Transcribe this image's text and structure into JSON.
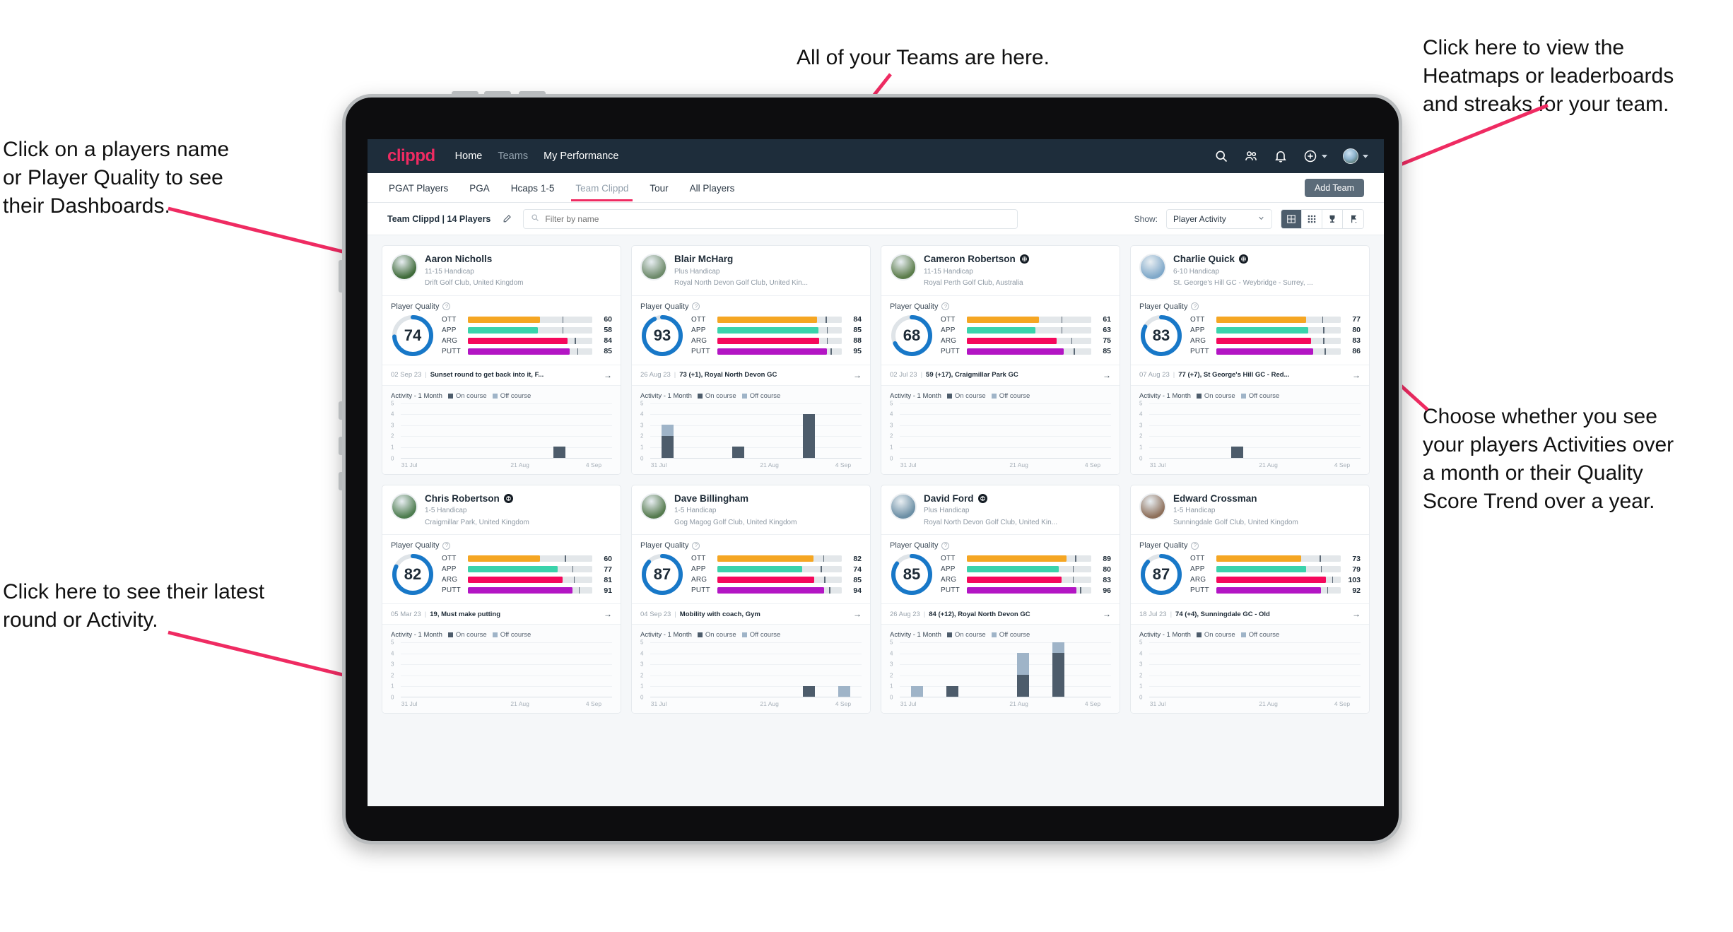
{
  "colors": {
    "brand_pink": "#ef2b62",
    "nav_bg": "#1e2d3b",
    "ott": "#f5a623",
    "app": "#3ad3ab",
    "arg": "#f5085c",
    "putt": "#b315c4",
    "donut": "#1878c8",
    "on_course": "#4d5c6b",
    "off_course": "#9fb4c8"
  },
  "annotations": [
    {
      "id": "teams-note",
      "text": "All of your Teams are here."
    },
    {
      "id": "heatmap-note",
      "text": "Click here to view the\nHeatmaps or leaderboards\nand streaks for your team."
    },
    {
      "id": "player-note",
      "text": "Click on a players name\nor Player Quality to see\ntheir Dashboards."
    },
    {
      "id": "activity-note",
      "text": "Choose whether you see\nyour players Activities over\na month or their Quality\nScore Trend over a year."
    },
    {
      "id": "latest-note",
      "text": "Click here to see their latest\nround or Activity."
    }
  ],
  "topnav": {
    "brand": "clippd",
    "links": [
      {
        "label": "Home",
        "active": true
      },
      {
        "label": "Teams",
        "active": false
      },
      {
        "label": "My Performance",
        "active": true
      }
    ],
    "icons": [
      "search-icon",
      "people-icon",
      "bell-icon",
      "plus-circle-icon",
      "avatar"
    ]
  },
  "tabs": [
    {
      "label": "PGAT Players",
      "state": "normal"
    },
    {
      "label": "PGA",
      "state": "normal"
    },
    {
      "label": "Hcaps 1-5",
      "state": "normal"
    },
    {
      "label": "Team Clippd",
      "state": "active"
    },
    {
      "label": "Tour",
      "state": "normal"
    },
    {
      "label": "All Players",
      "state": "normal"
    }
  ],
  "add_team_label": "Add Team",
  "toolbar": {
    "team_label": "Team Clippd | 14 Players",
    "edit_icon": "pencil-icon",
    "search_placeholder": "Filter by name",
    "search_value": "",
    "show_label": "Show:",
    "show_value": "Player Activity",
    "show_options": [
      "Player Activity",
      "Quality Score Trend"
    ],
    "views": [
      {
        "name": "grid-view",
        "icon": "grid-icon",
        "active": true
      },
      {
        "name": "dense-grid-view",
        "icon": "dense-grid-icon",
        "active": false
      },
      {
        "name": "leaderboard-view",
        "icon": "trophy-icon",
        "active": false
      },
      {
        "name": "heatmap-view",
        "icon": "flag-icon",
        "active": false
      }
    ]
  },
  "card_labels": {
    "player_quality": "Player Quality",
    "help_icon": "question-icon",
    "activity_title": "Activity - 1 Month",
    "legend_on": "On course",
    "legend_off": "Off course",
    "arrow_icon": "arrow-right-icon"
  },
  "chart_data": {
    "type": "bar",
    "title": "Activity - 1 Month",
    "xlabel": "",
    "ylabel": "",
    "ylim": [
      0,
      5
    ],
    "yticks": [
      5,
      4,
      3,
      2,
      1,
      0
    ],
    "categories": [
      "31 Jul",
      "21 Aug",
      "4 Sep"
    ],
    "tick_positions": [
      0,
      3,
      5
    ],
    "slots": 6,
    "grid": true,
    "legend": [
      "On course",
      "Off course"
    ],
    "legend_position": "top",
    "per_player": [
      {
        "player": "Aaron Nicholls",
        "on": [
          0,
          0,
          0,
          0,
          1,
          0
        ],
        "off": [
          0,
          0,
          0,
          0,
          0,
          0
        ]
      },
      {
        "player": "Blair McHarg",
        "on": [
          2,
          0,
          1,
          0,
          4,
          0
        ],
        "off": [
          1,
          0,
          0,
          0,
          0,
          0
        ]
      },
      {
        "player": "Cameron Robertson",
        "on": [
          0,
          0,
          0,
          0,
          0,
          0
        ],
        "off": [
          0,
          0,
          0,
          0,
          0,
          0
        ]
      },
      {
        "player": "Charlie Quick",
        "on": [
          0,
          0,
          1,
          0,
          0,
          0
        ],
        "off": [
          0,
          0,
          0,
          0,
          0,
          0
        ]
      },
      {
        "player": "Chris Robertson",
        "on": [
          0,
          0,
          0,
          0,
          0,
          0
        ],
        "off": [
          0,
          0,
          0,
          0,
          0,
          0
        ]
      },
      {
        "player": "Dave Billingham",
        "on": [
          0,
          0,
          0,
          0,
          1,
          0
        ],
        "off": [
          0,
          0,
          0,
          0,
          0,
          1
        ]
      },
      {
        "player": "David Ford",
        "on": [
          0,
          1,
          0,
          2,
          4,
          0
        ],
        "off": [
          1,
          0,
          0,
          2,
          1,
          0
        ]
      },
      {
        "player": "Edward Crossman",
        "on": [
          0,
          0,
          0,
          0,
          0,
          0
        ],
        "off": [
          0,
          0,
          0,
          0,
          0,
          0
        ]
      }
    ]
  },
  "players": [
    {
      "name": "Aaron Nicholls",
      "verified": false,
      "handicap": "11-15 Handicap",
      "club": "Drift Golf Club, United Kingdom",
      "avatar": "#3f6b3a",
      "quality": 74,
      "metrics": [
        {
          "label": "OTT",
          "value": 60,
          "fill": 58,
          "tick": 76
        },
        {
          "label": "APP",
          "value": 58,
          "fill": 56,
          "tick": 76
        },
        {
          "label": "ARG",
          "value": 84,
          "fill": 80,
          "tick": 86
        },
        {
          "label": "PUTT",
          "value": 85,
          "fill": 82,
          "tick": 88
        }
      ],
      "latest_date": "02 Sep 23",
      "latest_desc": "Sunset round to get back into it, F...",
      "activity_index": 0
    },
    {
      "name": "Blair McHarg",
      "verified": false,
      "handicap": "Plus Handicap",
      "club": "Royal North Devon Golf Club, United Kin...",
      "avatar": "#6d8a6a",
      "quality": 93,
      "metrics": [
        {
          "label": "OTT",
          "value": 84,
          "fill": 80,
          "tick": 87
        },
        {
          "label": "APP",
          "value": 85,
          "fill": 81,
          "tick": 88
        },
        {
          "label": "ARG",
          "value": 88,
          "fill": 82,
          "tick": 88
        },
        {
          "label": "PUTT",
          "value": 95,
          "fill": 88,
          "tick": 91
        }
      ],
      "latest_date": "26 Aug 23",
      "latest_desc": "73 (+1), Royal North Devon GC",
      "activity_index": 1
    },
    {
      "name": "Cameron Robertson",
      "verified": true,
      "handicap": "11-15 Handicap",
      "club": "Royal Perth Golf Club, Australia",
      "avatar": "#5b7c4a",
      "quality": 68,
      "metrics": [
        {
          "label": "OTT",
          "value": 61,
          "fill": 58,
          "tick": 76
        },
        {
          "label": "APP",
          "value": 63,
          "fill": 55,
          "tick": 76
        },
        {
          "label": "ARG",
          "value": 75,
          "fill": 72,
          "tick": 84
        },
        {
          "label": "PUTT",
          "value": 85,
          "fill": 78,
          "tick": 86
        }
      ],
      "latest_date": "02 Jul 23",
      "latest_desc": "59 (+17), Craigmillar Park GC",
      "activity_index": 2
    },
    {
      "name": "Charlie Quick",
      "verified": true,
      "handicap": "6-10 Handicap",
      "club": "St. George's Hill GC - Weybridge - Surrey, ...",
      "avatar": "#7fa8c9",
      "quality": 83,
      "metrics": [
        {
          "label": "OTT",
          "value": 77,
          "fill": 72,
          "tick": 85
        },
        {
          "label": "APP",
          "value": 80,
          "fill": 74,
          "tick": 86
        },
        {
          "label": "ARG",
          "value": 83,
          "fill": 76,
          "tick": 86
        },
        {
          "label": "PUTT",
          "value": 86,
          "fill": 78,
          "tick": 87
        }
      ],
      "latest_date": "07 Aug 23",
      "latest_desc": "77 (+7), St George's Hill GC - Red...",
      "activity_index": 3
    },
    {
      "name": "Chris Robertson",
      "verified": true,
      "handicap": "1-5 Handicap",
      "club": "Craigmillar Park, United Kingdom",
      "avatar": "#4d7c4f",
      "quality": 82,
      "metrics": [
        {
          "label": "OTT",
          "value": 60,
          "fill": 58,
          "tick": 78
        },
        {
          "label": "APP",
          "value": 77,
          "fill": 72,
          "tick": 84
        },
        {
          "label": "ARG",
          "value": 81,
          "fill": 76,
          "tick": 85
        },
        {
          "label": "PUTT",
          "value": 91,
          "fill": 84,
          "tick": 89
        }
      ],
      "latest_date": "05 Mar 23",
      "latest_desc": "19, Must make putting",
      "activity_index": 4
    },
    {
      "name": "Dave Billingham",
      "verified": false,
      "handicap": "1-5 Handicap",
      "club": "Gog Magog Golf Club, United Kingdom",
      "avatar": "#557a4e",
      "quality": 87,
      "metrics": [
        {
          "label": "OTT",
          "value": 82,
          "fill": 77,
          "tick": 85
        },
        {
          "label": "APP",
          "value": 74,
          "fill": 68,
          "tick": 83
        },
        {
          "label": "ARG",
          "value": 85,
          "fill": 78,
          "tick": 86
        },
        {
          "label": "PUTT",
          "value": 94,
          "fill": 86,
          "tick": 90
        }
      ],
      "latest_date": "04 Sep 23",
      "latest_desc": "Mobility with coach, Gym",
      "activity_index": 5
    },
    {
      "name": "David Ford",
      "verified": true,
      "handicap": "Plus Handicap",
      "club": "Royal North Devon Golf Club, United Kin...",
      "avatar": "#6c8fa5",
      "quality": 85,
      "metrics": [
        {
          "label": "OTT",
          "value": 89,
          "fill": 80,
          "tick": 87
        },
        {
          "label": "APP",
          "value": 80,
          "fill": 74,
          "tick": 85
        },
        {
          "label": "ARG",
          "value": 83,
          "fill": 76,
          "tick": 85
        },
        {
          "label": "PUTT",
          "value": 96,
          "fill": 88,
          "tick": 91
        }
      ],
      "latest_date": "26 Aug 23",
      "latest_desc": "84 (+12), Royal North Devon GC",
      "activity_index": 6
    },
    {
      "name": "Edward Crossman",
      "verified": false,
      "handicap": "1-5 Handicap",
      "club": "Sunningdale Golf Club, United Kingdom",
      "avatar": "#8d6f5a",
      "quality": 87,
      "metrics": [
        {
          "label": "OTT",
          "value": 73,
          "fill": 68,
          "tick": 83
        },
        {
          "label": "APP",
          "value": 79,
          "fill": 72,
          "tick": 84
        },
        {
          "label": "ARG",
          "value": 103,
          "fill": 88,
          "tick": 93
        },
        {
          "label": "PUTT",
          "value": 92,
          "fill": 84,
          "tick": 89
        }
      ],
      "latest_date": "18 Jul 23",
      "latest_desc": "74 (+4), Sunningdale GC - Old",
      "activity_index": 7
    }
  ]
}
